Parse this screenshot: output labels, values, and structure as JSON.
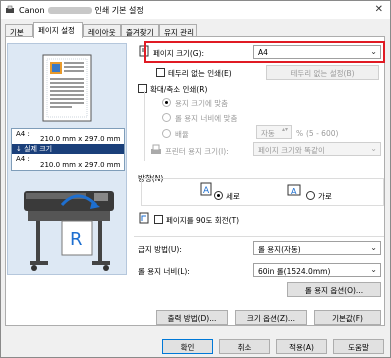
{
  "window": {
    "title_left": "Canon",
    "title_right": "인쇄 기본 설정",
    "close_glyph": "✕"
  },
  "tabs": [
    {
      "label": "기본"
    },
    {
      "label": "페이지 설정"
    },
    {
      "label": "레이아웃"
    },
    {
      "label": "즐겨찾기"
    },
    {
      "label": "유지 관리"
    }
  ],
  "preview": {
    "media_label1": "A4 :",
    "media_size1": "210.0 mm x 297.0 mm",
    "arrow_label": "↓ 실제 크기",
    "media_label2": "A4 :",
    "media_size2": "210.0 mm x 297.0 mm"
  },
  "page_size": {
    "label": "페이지 크기(G):",
    "value": "A4"
  },
  "borderless": {
    "label": "테두리 없는 인쇄(E)",
    "button": "테두리 없는 설정(B)",
    "checked": false
  },
  "scaled": {
    "label": "확대/축소 인쇄(R)",
    "checked": false,
    "fit_paper": "용지 크기에 맞춤",
    "fit_roll": "롤 용지 너비에 맞춤",
    "scaling": "배율",
    "scaling_value": "자동",
    "scaling_unit": "%",
    "scaling_range": "(5 - 600)",
    "printer_paper_label": "프린터 용지 크기(I):",
    "printer_paper_value": "페이지 크기와 똑같이"
  },
  "orientation": {
    "group_label": "방향(N)",
    "portrait": "세로",
    "landscape": "가로",
    "selected": "portrait"
  },
  "rotate": {
    "label": "페이지를 90도 회전(T)",
    "checked": false
  },
  "paper_source": {
    "label": "급지 방법(U):",
    "value": "롤 용지(자동)"
  },
  "roll_width": {
    "label": "롤 용지 너비(L):",
    "value": "60in 롤(1524.0mm)"
  },
  "roll_options_button": "롤 용지 옵션(O)...",
  "bottom_buttons": {
    "output": "출력 방법(D)...",
    "size_options": "크기 옵션(Z)...",
    "defaults": "기본값(F)"
  },
  "dialog_buttons": {
    "ok": "확인",
    "cancel": "취소",
    "apply": "적용(A)",
    "help": "도움말"
  },
  "colors": {
    "highlight": "#e01b24",
    "accent": "#0078d7"
  }
}
